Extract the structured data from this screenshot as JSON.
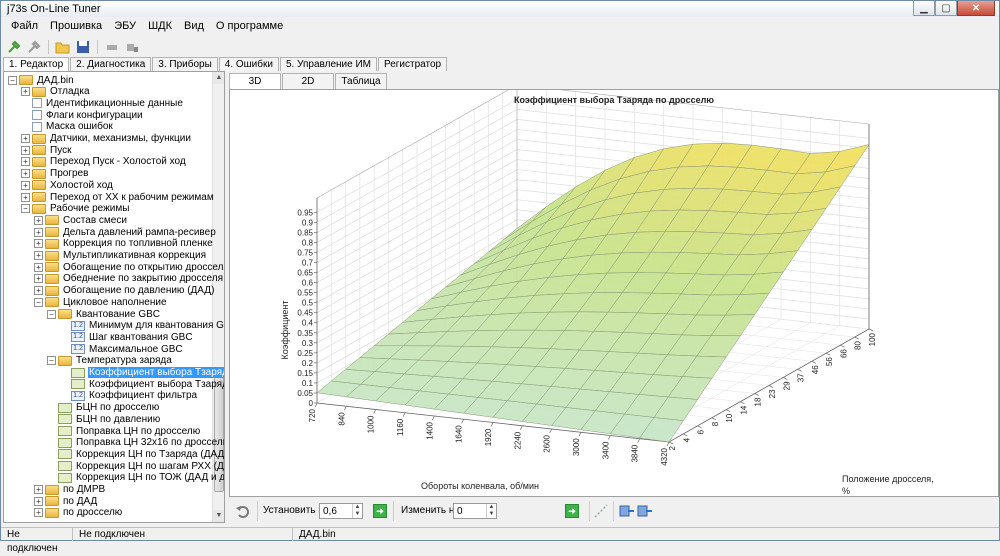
{
  "window": {
    "title": "j73s On-Line Tuner"
  },
  "menu": [
    "Файл",
    "Прошивка",
    "ЭБУ",
    "ШДК",
    "Вид",
    "О программе"
  ],
  "main_tabs": [
    "1. Редактор",
    "2. Диагностика",
    "3. Приборы",
    "4. Ошибки",
    "5. Управление ИМ",
    "Регистратор"
  ],
  "tree": [
    {
      "label": "ДАД.bin",
      "icon": "folder-icon",
      "exp": "−"
    },
    {
      "label": "Отладка",
      "icon": "folder-icon",
      "exp": "+"
    },
    {
      "label": "Идентификационные данные",
      "icon": "document-icon"
    },
    {
      "label": "Флаги конфигурации",
      "icon": "document-icon"
    },
    {
      "label": "Маска ошибок",
      "icon": "document-icon"
    },
    {
      "label": "Датчики, механизмы, функции",
      "icon": "folder-icon",
      "exp": "+"
    },
    {
      "label": "Пуск",
      "icon": "folder-icon",
      "exp": "+"
    },
    {
      "label": "Переход Пуск - Холостой ход",
      "icon": "folder-icon",
      "exp": "+"
    },
    {
      "label": "Прогрев",
      "icon": "folder-icon",
      "exp": "+"
    },
    {
      "label": "Холостой ход",
      "icon": "folder-icon",
      "exp": "+"
    },
    {
      "label": "Переход от ХХ к рабочим режимам",
      "icon": "folder-icon",
      "exp": "+"
    },
    {
      "label": "Рабочие режимы",
      "icon": "folder-icon",
      "exp": "−"
    },
    {
      "label": "Состав смеси",
      "icon": "folder-icon",
      "exp": "+"
    },
    {
      "label": "Дельта давлений рампа-ресивер",
      "icon": "folder-icon",
      "exp": "+"
    },
    {
      "label": "Коррекция по топливной пленке",
      "icon": "folder-icon",
      "exp": "+"
    },
    {
      "label": "Мультипликативная коррекция",
      "icon": "folder-icon",
      "exp": "+"
    },
    {
      "label": "Обогащение по открытию дросселя",
      "icon": "folder-icon",
      "exp": "+"
    },
    {
      "label": "Обеднение по закрытию дросселя",
      "icon": "folder-icon",
      "exp": "+"
    },
    {
      "label": "Обогащение по давлению (ДАД)",
      "icon": "folder-icon",
      "exp": "+"
    },
    {
      "label": "Цикловое наполнение",
      "icon": "folder-icon",
      "exp": "−"
    },
    {
      "label": "Квантование GBC",
      "icon": "folder-icon",
      "exp": "−"
    },
    {
      "label": "Минимум для квантования GBC",
      "icon": "number-icon"
    },
    {
      "label": "Шаг квантования GBC",
      "icon": "number-icon"
    },
    {
      "label": "Максимальное GBC",
      "icon": "number-icon"
    },
    {
      "label": "Температура заряда",
      "icon": "folder-icon",
      "exp": "−"
    },
    {
      "label": "Коэффициент выбора Тзаряда по",
      "icon": "chart-icon",
      "selected": true
    },
    {
      "label": "Коэффициент выбора Тзаряда по",
      "icon": "chart-icon"
    },
    {
      "label": "Коэффициент фильтра",
      "icon": "number-icon"
    },
    {
      "label": "БЦН по дросселю",
      "icon": "chart-icon"
    },
    {
      "label": "БЦН по давлению",
      "icon": "chart-icon"
    },
    {
      "label": "Поправка ЦН по дросселю",
      "icon": "chart-icon"
    },
    {
      "label": "Поправка ЦН 32х16 по дросселю",
      "icon": "chart-icon"
    },
    {
      "label": "Коррекция ЦН по Тзаряда  (ДАД и д",
      "icon": "chart-icon"
    },
    {
      "label": "Коррекция ЦН по шагам РХХ  (ДАД",
      "icon": "chart-icon"
    },
    {
      "label": "Коррекция ЦН по ТОЖ  (ДАД и дрос",
      "icon": "chart-icon"
    },
    {
      "label": "по ДМРВ",
      "icon": "folder-icon",
      "exp": "+"
    },
    {
      "label": "по ДАД",
      "icon": "folder-icon",
      "exp": "+"
    },
    {
      "label": "по дросселю",
      "icon": "folder-icon",
      "exp": "+"
    }
  ],
  "sub_tabs": [
    "3D",
    "2D",
    "Таблица"
  ],
  "chart_data": {
    "type": "surface",
    "title": "Коэффициент выбора Тзаряда по дросселю",
    "zlabel": "Коэффициент",
    "xlabel": "Обороты коленвала, об/мин",
    "ylabel": "Положение дросселя, %",
    "z_ticks": [
      "0",
      "0.05",
      "0.1",
      "0.15",
      "0.2",
      "0.25",
      "0.3",
      "0.35",
      "0.4",
      "0.45",
      "0.5",
      "0.55",
      "0.6",
      "0.65",
      "0.7",
      "0.75",
      "0.8",
      "0.85",
      "0.9",
      "0.95"
    ],
    "x_ticks": [
      "720",
      "840",
      "1000",
      "1160",
      "1400",
      "1640",
      "1920",
      "2240",
      "2600",
      "3000",
      "3400",
      "3840",
      "4320"
    ],
    "y_ticks": [
      "2",
      "4",
      "6",
      "8",
      "10",
      "14",
      "18",
      "23",
      "29",
      "37",
      "46",
      "56",
      "66",
      "80",
      "100"
    ],
    "surface_corners": {
      "low_rpm_low_throttle": 0.05,
      "low_rpm_high_throttle": 0.3,
      "high_rpm_low_throttle": 0.0,
      "high_rpm_high_throttle": 0.9
    },
    "colors": {
      "low": "#c8e6c9",
      "mid": "#c7e38a",
      "high": "#f7de57"
    }
  },
  "bottom": {
    "set_label": "Установить в",
    "set_value": "0,6",
    "change_label": "Изменить на",
    "change_value": "0"
  },
  "status": [
    "Не подключен",
    "Не подключен",
    "ДАД.bin"
  ]
}
